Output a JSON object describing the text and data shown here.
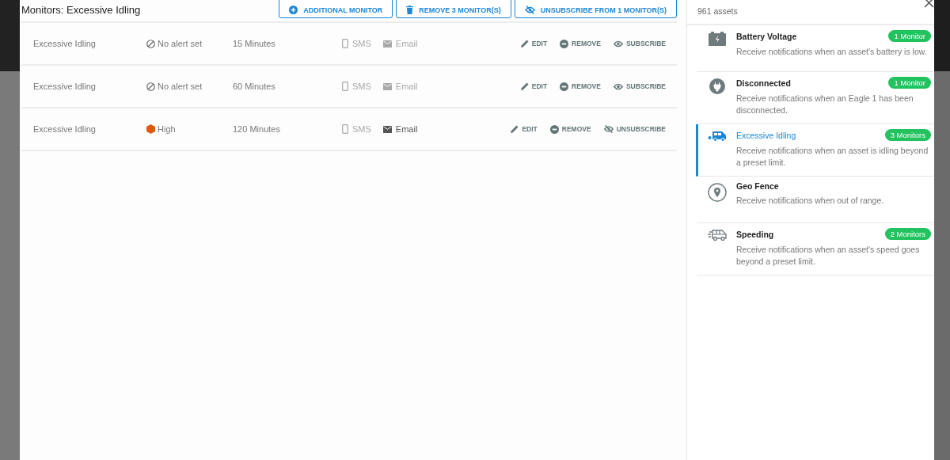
{
  "main": {
    "title": "Monitors: Excessive Idling",
    "buttons": [
      {
        "kind": "add",
        "label": "ADDITIONAL MONITOR"
      },
      {
        "kind": "trash",
        "label": "REMOVE 3 MONITOR(S)"
      },
      {
        "kind": "unsubscribe",
        "label": "UNSUBSCRIBE FROM 1 MONITOR(S)"
      }
    ],
    "rows": [
      {
        "name": "Excessive Idling",
        "alert": {
          "kind": "none",
          "label": "No alert set"
        },
        "duration": "15 Minutes",
        "sms": {
          "label": "SMS",
          "enabled": false
        },
        "email": {
          "label": "Email",
          "enabled": false
        },
        "actions": [
          {
            "kind": "edit",
            "label": "EDIT"
          },
          {
            "kind": "remove",
            "label": "REMOVE"
          },
          {
            "kind": "subscribe",
            "label": "SUBSCRIBE"
          }
        ]
      },
      {
        "name": "Excessive Idling",
        "alert": {
          "kind": "none",
          "label": "No alert set"
        },
        "duration": "60 Minutes",
        "sms": {
          "label": "SMS",
          "enabled": false
        },
        "email": {
          "label": "Email",
          "enabled": false
        },
        "actions": [
          {
            "kind": "edit",
            "label": "EDIT"
          },
          {
            "kind": "remove",
            "label": "REMOVE"
          },
          {
            "kind": "subscribe",
            "label": "SUBSCRIBE"
          }
        ]
      },
      {
        "name": "Excessive Idling",
        "alert": {
          "kind": "level",
          "label": "High",
          "color": "#e05a0c"
        },
        "duration": "120 Minutes",
        "sms": {
          "label": "SMS",
          "enabled": false
        },
        "email": {
          "label": "Email",
          "enabled": true
        },
        "actions": [
          {
            "kind": "edit",
            "label": "EDIT"
          },
          {
            "kind": "remove",
            "label": "REMOVE"
          },
          {
            "kind": "unsubscribe",
            "label": "UNSUBSCRIBE"
          }
        ]
      }
    ]
  },
  "sidebar": {
    "subtitle": "961 assets",
    "items": [
      {
        "kind": "battery",
        "title": "Battery Voltage",
        "badge": "1 Monitor",
        "description": "Receive notifications when an asset's battery is low.",
        "selected": false
      },
      {
        "kind": "plug",
        "title": "Disconnected",
        "badge": "1 Monitor",
        "description": "Receive notifications when an Eagle 1 has been disconnected.",
        "selected": false
      },
      {
        "kind": "van",
        "title": "Excessive Idling",
        "badge": "3 Monitors",
        "description": "Receive notifications when an asset is idling beyond a preset limit.",
        "selected": true
      },
      {
        "kind": "pin",
        "title": "Geo Fence",
        "description": "Receive notifications when out of range.",
        "selected": false
      },
      {
        "kind": "speed",
        "title": "Speeding",
        "badge": "2 Monitors",
        "description": "Receive notifications when an asset's speed goes beyond a preset limit.",
        "selected": false
      }
    ]
  }
}
